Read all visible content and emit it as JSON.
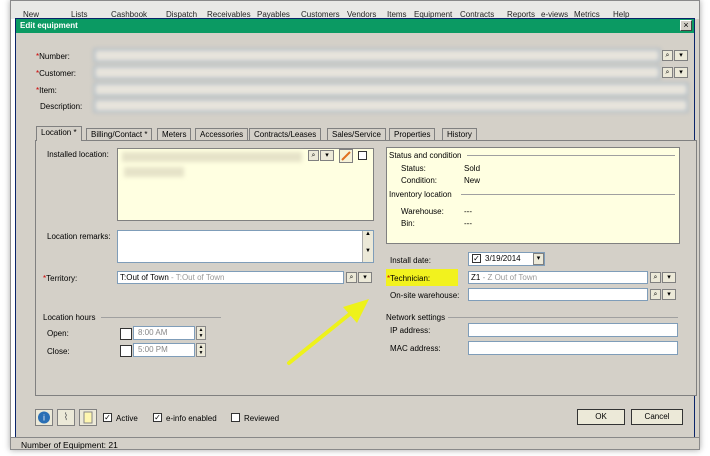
{
  "toolbar": {
    "items": [
      "New",
      "Lists",
      "Cashbook",
      "Dispatch",
      "Receivables",
      "Payables",
      "Customers",
      "Vendors",
      "Items",
      "Equipment",
      "Contracts",
      "Reports",
      "e-views",
      "Metrics",
      "Help"
    ]
  },
  "dialog": {
    "title": "Edit equipment",
    "close_glyph": "×"
  },
  "header": {
    "number_label": "Number:",
    "customer_label": "Customer:",
    "item_label": "Item:",
    "description_label": "Description:",
    "required_mark": "*"
  },
  "tabs": [
    {
      "label": "Location *"
    },
    {
      "label": "Billing/Contact *"
    },
    {
      "label": "Meters"
    },
    {
      "label": "Accessories"
    },
    {
      "label": "Contracts/Leases"
    },
    {
      "label": "Sales/Service"
    },
    {
      "label": "Properties"
    },
    {
      "label": "History"
    }
  ],
  "location": {
    "installed_location_label": "Installed location:",
    "location_remarks_label": "Location remarks:",
    "territory_label": "Territory:",
    "territory_value": "T:Out of Town",
    "territory_hint": " - T:Out of Town",
    "location_hours_label": "Location hours",
    "open_label": "Open:",
    "open_value": "8:00 AM",
    "close_label": "Close:",
    "close_value": "5:00 PM"
  },
  "status": {
    "section_label": "Status and condition",
    "status_label": "Status:",
    "status_value": "Sold",
    "condition_label": "Condition:",
    "condition_value": "New",
    "inventory_label": "Inventory location",
    "warehouse_label": "Warehouse:",
    "warehouse_value": "---",
    "bin_label": "Bin:",
    "bin_value": "---"
  },
  "service": {
    "install_date_label": "Install date:",
    "install_date_value": "3/19/2014",
    "technician_label": "Technician:",
    "technician_value": "Z1",
    "technician_hint": " - Z Out of Town",
    "onsite_warehouse_label": "On-site warehouse:"
  },
  "network": {
    "section_label": "Network settings",
    "ip_label": "IP address:",
    "mac_label": "MAC address:"
  },
  "footer": {
    "active_label": "Active",
    "einfo_label": "e-info enabled",
    "reviewed_label": "Reviewed",
    "ok_label": "OK",
    "cancel_label": "Cancel"
  },
  "statusbar": {
    "text": "Number of Equipment: 21"
  },
  "colors": {
    "titlebar": "#0b9a63",
    "highlight": "#f2f21e",
    "arrow": "#eef21a"
  }
}
